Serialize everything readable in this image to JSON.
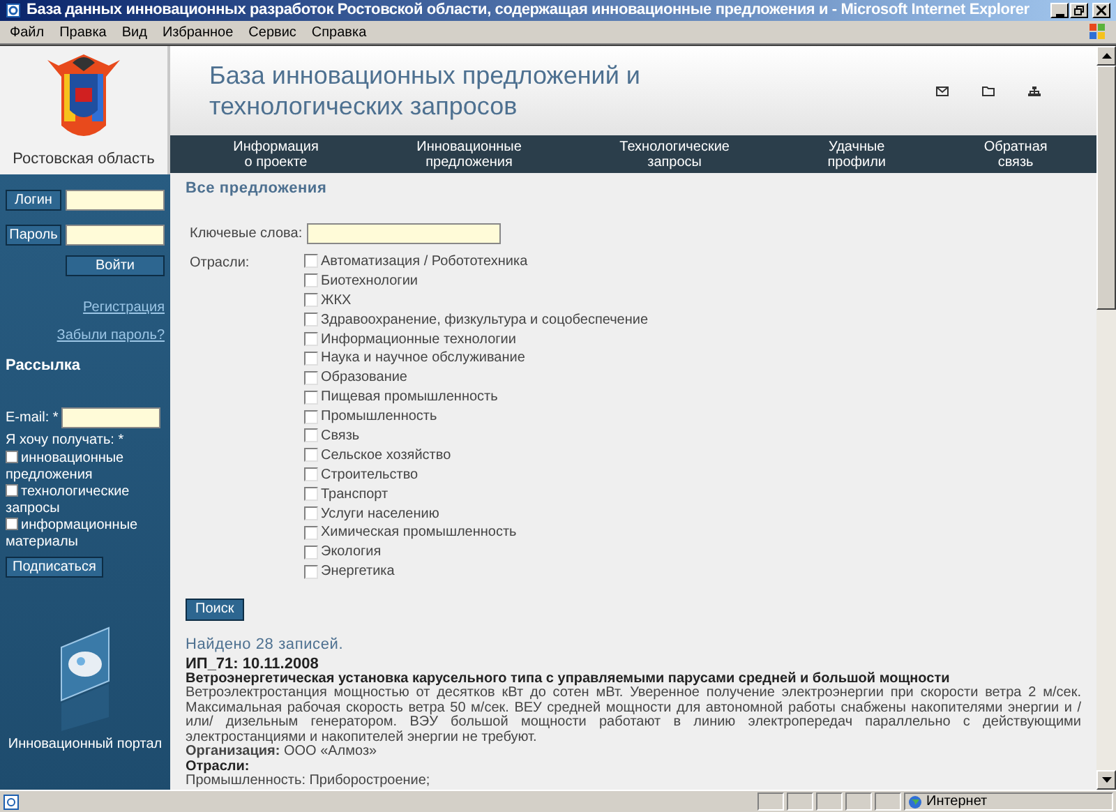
{
  "window": {
    "title": "База данных инновационных разработок Ростовской области, содержащая инновационные предложения и - Microsoft Internet Explorer"
  },
  "menu": [
    "Файл",
    "Правка",
    "Вид",
    "Избранное",
    "Сервис",
    "Справка"
  ],
  "logo": {
    "caption": "Ростовская область"
  },
  "header": {
    "title": "База инновационных предложений и технологических запросов"
  },
  "nav": [
    "Информация\nо проекте",
    "Инновационные\nпредложения",
    "Технологические\nзапросы",
    "Удачные\nпрофили",
    "Обратная\nсвязь"
  ],
  "login": {
    "login_label": "Логин",
    "password_label": "Пароль",
    "submit": "Войти",
    "register": "Регистрация",
    "forgot": "Забыли пароль?"
  },
  "newsletter": {
    "title": "Рассылка",
    "email_label": "E-mail: *",
    "want_label": "Я хочу получать: *",
    "options": [
      {
        "label": "инновационные предложения",
        "checked": false
      },
      {
        "label": "технологические запросы",
        "checked": false
      },
      {
        "label": "информационные материалы",
        "checked": false
      }
    ],
    "submit": "Подписаться"
  },
  "portal": {
    "caption": "Инновационный портал"
  },
  "search": {
    "heading": "Все предложения",
    "keywords_label": "Ключевые слова:",
    "sectors_label": "Отрасли:",
    "sectors": [
      {
        "label": "Автоматизация / Робототехника",
        "checked": false
      },
      {
        "label": "Биотехнологии",
        "checked": false
      },
      {
        "label": "ЖКХ",
        "checked": false
      },
      {
        "label": "Здравоохранение, физкультура и соцобеспечение",
        "checked": false
      },
      {
        "label": "Информационные технологии",
        "checked": false
      },
      {
        "label": "Наука и научное обслуживание",
        "checked": false
      },
      {
        "label": "Образование",
        "checked": false
      },
      {
        "label": "Пищевая промышленность",
        "checked": false
      },
      {
        "label": "Промышленность",
        "checked": false
      },
      {
        "label": "Связь",
        "checked": false
      },
      {
        "label": "Сельское хозяйство",
        "checked": false
      },
      {
        "label": "Строительство",
        "checked": false
      },
      {
        "label": "Транспорт",
        "checked": false
      },
      {
        "label": "Услуги населению",
        "checked": false
      },
      {
        "label": "Химическая промышленность",
        "checked": false
      },
      {
        "label": "Экология",
        "checked": false
      },
      {
        "label": "Энергетика",
        "checked": false
      }
    ],
    "submit": "Поиск"
  },
  "results": {
    "found": "Найдено 28 записей.",
    "items": [
      {
        "id_date": "ИП_71: 10.11.2008",
        "title": "Ветроэнергетическая установка карусельного типа с управляемыми парусами средней и большой мощности",
        "description": "Ветроэлектростанция мощностью от десятков кВт до сотен мВт. Уверенное получение электроэнергии при скорости ветра 2 м/сек. Максимальная рабочая скорость ветра 50 м/сек. ВЕУ средней мощности для автономной работы снабжены накопителями энергии и /или/ дизельным генератором. ВЭУ большой мощности работают в линию электропередач параллельно с действующими электростанциями и накопителей энергии не требуют.",
        "organization": "**Организация:** ООО «Алмоз»",
        "sectors_label": "Отрасли:",
        "sectors": "Промышленность: Приборостроение;"
      }
    ]
  },
  "status_bar": {
    "zone": "Интернет"
  }
}
